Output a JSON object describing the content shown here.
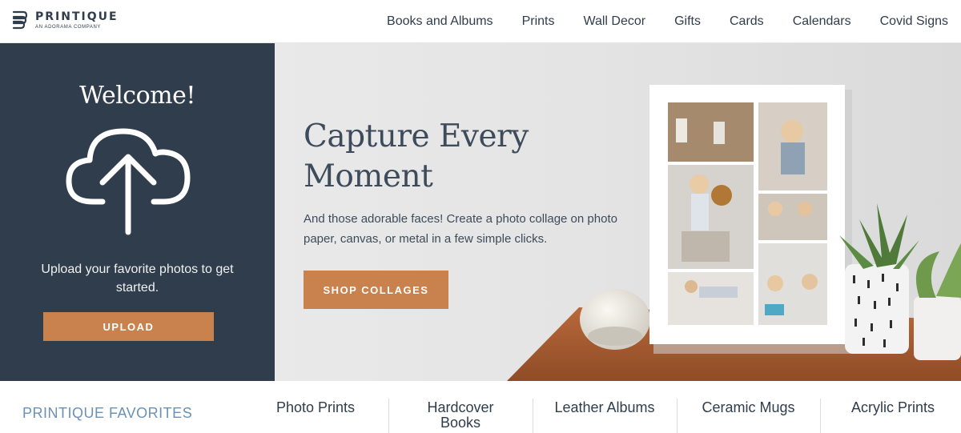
{
  "header": {
    "logo_name": "PRINTIQUE",
    "logo_sub": "AN ADORAMA COMPANY",
    "nav": [
      "Books and Albums",
      "Prints",
      "Wall Decor",
      "Gifts",
      "Cards",
      "Calendars",
      "Covid Signs"
    ]
  },
  "welcome": {
    "title": "Welcome!",
    "icon": "cloud-upload-icon",
    "text": "Upload your favorite photos to get started.",
    "upload_label": "UPLOAD"
  },
  "hero": {
    "title": "Capture Every Moment",
    "subtitle": "And those adorable faces! Create a photo collage on photo paper, canvas, or metal in a few simple clicks.",
    "cta_label": "SHOP COLLAGES"
  },
  "favorites": {
    "title": "PRINTIQUE FAVORITES",
    "items": [
      "Photo Prints",
      "Hardcover Books",
      "Leather Albums",
      "Ceramic Mugs",
      "Acrylic Prints"
    ]
  },
  "colors": {
    "navy": "#2f3d4c",
    "accent": "#c9824e",
    "link_blue": "#6b91b7"
  }
}
